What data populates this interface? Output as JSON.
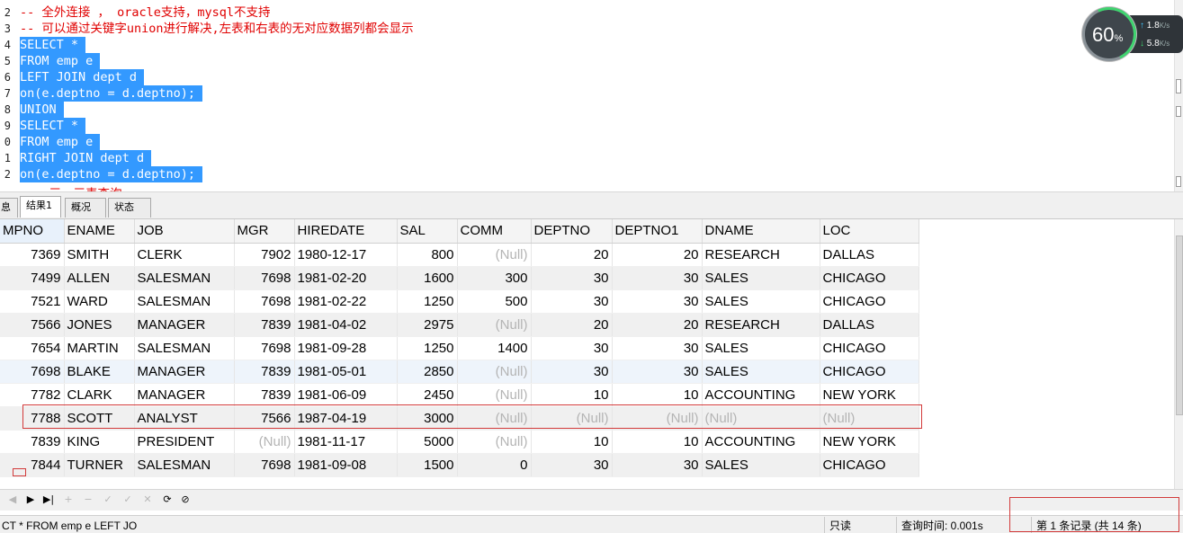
{
  "editor": {
    "lines": [
      {
        "num": "2",
        "text": "-- 全外连接 ， oracle支持，mysql不支持",
        "style": "comment"
      },
      {
        "num": "3",
        "text": "-- 可以通过关键字union进行解决,左表和右表的无对应数据列都会显示",
        "style": "comment"
      },
      {
        "num": "4",
        "text": "SELECT *",
        "style": "sel"
      },
      {
        "num": "5",
        "text": "FROM emp e",
        "style": "sel"
      },
      {
        "num": "6",
        "text": "LEFT JOIN dept d",
        "style": "sel"
      },
      {
        "num": "7",
        "text": "on(e.deptno = d.deptno);",
        "style": "sel"
      },
      {
        "num": "8",
        "text": "UNION",
        "style": "sel"
      },
      {
        "num": "9",
        "text": "SELECT *",
        "style": "sel"
      },
      {
        "num": "0",
        "text": "FROM emp e",
        "style": "sel"
      },
      {
        "num": "1",
        "text": "RIGHT JOIN dept d",
        "style": "sel"
      },
      {
        "num": "2",
        "text": "on(e.deptno = d.deptno);",
        "style": "sel"
      },
      {
        "num": "",
        "text": "    三、三表查询",
        "style": "partial"
      }
    ]
  },
  "speed": {
    "percent": "60",
    "percent_unit": "%",
    "upload": "1.8",
    "download": "5.8",
    "unit": "K/s"
  },
  "tabs": [
    {
      "label": "息",
      "active": false
    },
    {
      "label": "结果1",
      "active": true
    },
    {
      "label": "概况",
      "active": false
    },
    {
      "label": "状态",
      "active": false
    }
  ],
  "grid": {
    "columns": [
      "MPNO",
      "ENAME",
      "JOB",
      "MGR",
      "HIREDATE",
      "SAL",
      "COMM",
      "DEPTNO",
      "DEPTNO1",
      "DNAME",
      "LOC"
    ],
    "rows": [
      [
        "7369",
        "SMITH",
        "CLERK",
        "7902",
        "1980-12-17",
        "800",
        "(Null)",
        "20",
        "20",
        "RESEARCH",
        "DALLAS"
      ],
      [
        "7499",
        "ALLEN",
        "SALESMAN",
        "7698",
        "1981-02-20",
        "1600",
        "300",
        "30",
        "30",
        "SALES",
        "CHICAGO"
      ],
      [
        "7521",
        "WARD",
        "SALESMAN",
        "7698",
        "1981-02-22",
        "1250",
        "500",
        "30",
        "30",
        "SALES",
        "CHICAGO"
      ],
      [
        "7566",
        "JONES",
        "MANAGER",
        "7839",
        "1981-04-02",
        "2975",
        "(Null)",
        "20",
        "20",
        "RESEARCH",
        "DALLAS"
      ],
      [
        "7654",
        "MARTIN",
        "SALESMAN",
        "7698",
        "1981-09-28",
        "1250",
        "1400",
        "30",
        "30",
        "SALES",
        "CHICAGO"
      ],
      [
        "7698",
        "BLAKE",
        "MANAGER",
        "7839",
        "1981-05-01",
        "2850",
        "(Null)",
        "30",
        "30",
        "SALES",
        "CHICAGO"
      ],
      [
        "7782",
        "CLARK",
        "MANAGER",
        "7839",
        "1981-06-09",
        "2450",
        "(Null)",
        "10",
        "10",
        "ACCOUNTING",
        "NEW YORK"
      ],
      [
        "7788",
        "SCOTT",
        "ANALYST",
        "7566",
        "1987-04-19",
        "3000",
        "(Null)",
        "(Null)",
        "(Null)",
        "(Null)",
        "(Null)"
      ],
      [
        "7839",
        "KING",
        "PRESIDENT",
        "(Null)",
        "1981-11-17",
        "5000",
        "(Null)",
        "10",
        "10",
        "ACCOUNTING",
        "NEW YORK"
      ],
      [
        "7844",
        "TURNER",
        "SALESMAN",
        "7698",
        "1981-09-08",
        "1500",
        "0",
        "30",
        "30",
        "SALES",
        "CHICAGO"
      ]
    ]
  },
  "navbar": {
    "buttons": [
      {
        "name": "first-record",
        "glyph": "◀",
        "enabled": false
      },
      {
        "name": "next-record",
        "glyph": "▶",
        "enabled": true
      },
      {
        "name": "last-record",
        "glyph": "▶|",
        "enabled": true
      },
      {
        "name": "add-record",
        "glyph": "+",
        "enabled": false
      },
      {
        "name": "delete-record",
        "glyph": "−",
        "enabled": false
      },
      {
        "name": "edit-record",
        "glyph": "✓",
        "enabled": false
      },
      {
        "name": "apply-changes",
        "glyph": "✓",
        "enabled": false
      },
      {
        "name": "discard-changes",
        "glyph": "✕",
        "enabled": false
      },
      {
        "name": "refresh",
        "glyph": "⟳",
        "enabled": true
      },
      {
        "name": "stop",
        "glyph": "⊘",
        "enabled": true
      }
    ]
  },
  "status": {
    "sql": "CT * FROM emp e LEFT JO",
    "readonly": "只读",
    "query_time": "查询时间: 0.001s",
    "record": "第 1 条记录 (共 14 条)"
  }
}
